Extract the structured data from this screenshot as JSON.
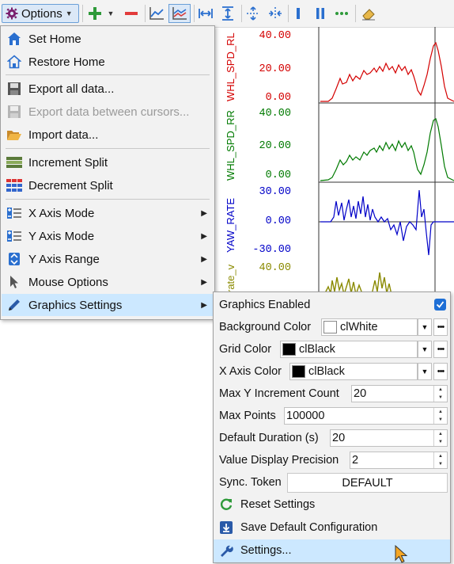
{
  "toolbar": {
    "options_label": "Options",
    "icons": [
      "gear-icon",
      "add-icon",
      "remove-icon",
      "line-chart-icon",
      "multi-line-chart-icon",
      "fit-width-icon",
      "fit-height-icon",
      "cursor-split-icon",
      "cursor-merge-icon",
      "single-bar-icon",
      "double-bar-icon",
      "ellipsis-icon",
      "eraser-icon"
    ]
  },
  "menu": {
    "items": [
      {
        "label": "Set Home",
        "icon": "home-icon"
      },
      {
        "label": "Restore Home",
        "icon": "home-outline-icon"
      },
      {
        "label": "Export all data...",
        "icon": "save-icon"
      },
      {
        "label": "Export data between cursors...",
        "icon": "save-disabled-icon",
        "disabled": true
      },
      {
        "label": "Import data...",
        "icon": "folder-open-icon"
      },
      {
        "label": "Increment Split",
        "icon": "increment-split-icon"
      },
      {
        "label": "Decrement Split",
        "icon": "decrement-split-icon"
      },
      {
        "label": "X Axis Mode",
        "icon": "x-axis-mode-icon",
        "submenu": true
      },
      {
        "label": "Y Axis Mode",
        "icon": "y-axis-mode-icon",
        "submenu": true
      },
      {
        "label": "Y Axis Range",
        "icon": "y-axis-range-icon",
        "submenu": true
      },
      {
        "label": "Mouse Options",
        "icon": "mouse-pointer-icon",
        "submenu": true
      },
      {
        "label": "Graphics Settings",
        "icon": "pencil-icon",
        "submenu": true,
        "highlighted": true
      }
    ]
  },
  "submenu": {
    "graphics_enabled": {
      "label": "Graphics Enabled",
      "checked": true
    },
    "background_color": {
      "label": "Background Color",
      "value": "clWhite",
      "swatch": "#ffffff"
    },
    "grid_color": {
      "label": "Grid Color",
      "value": "clBlack",
      "swatch": "#000000"
    },
    "x_axis_color": {
      "label": "X Axis Color",
      "value": "clBlack",
      "swatch": "#000000"
    },
    "max_y_increment": {
      "label": "Max Y Increment Count",
      "value": "20"
    },
    "max_points": {
      "label": "Max Points",
      "value": "100000"
    },
    "default_duration": {
      "label": "Default Duration (s)",
      "value": "20"
    },
    "value_precision": {
      "label": "Value Display Precision",
      "value": "2"
    },
    "sync_token": {
      "label": "Sync. Token",
      "value": "DEFAULT"
    },
    "reset_settings": {
      "label": "Reset Settings",
      "icon": "refresh-icon"
    },
    "save_default": {
      "label": "Save Default Configuration",
      "icon": "download-icon"
    },
    "settings": {
      "label": "Settings...",
      "icon": "wrench-icon",
      "highlighted": true
    }
  },
  "plots": [
    {
      "label": "WHL_SPD_RL",
      "color": "#d40000",
      "ticks": [
        "40.00",
        "20.00",
        "0.00"
      ]
    },
    {
      "label": "WHL_SPD_RR",
      "color": "#007a00",
      "ticks": [
        "40.00",
        "20.00",
        "0.00"
      ]
    },
    {
      "label": "YAW_RATE",
      "color": "#0000c8",
      "ticks": [
        "30.00",
        "0.00",
        "-30.00"
      ]
    },
    {
      "label": "rate_v",
      "color": "#8a8a00",
      "ticks": [
        "40.00"
      ]
    }
  ],
  "colors": {
    "highlight": "#cce8ff",
    "accent": "#1e6fd6"
  }
}
